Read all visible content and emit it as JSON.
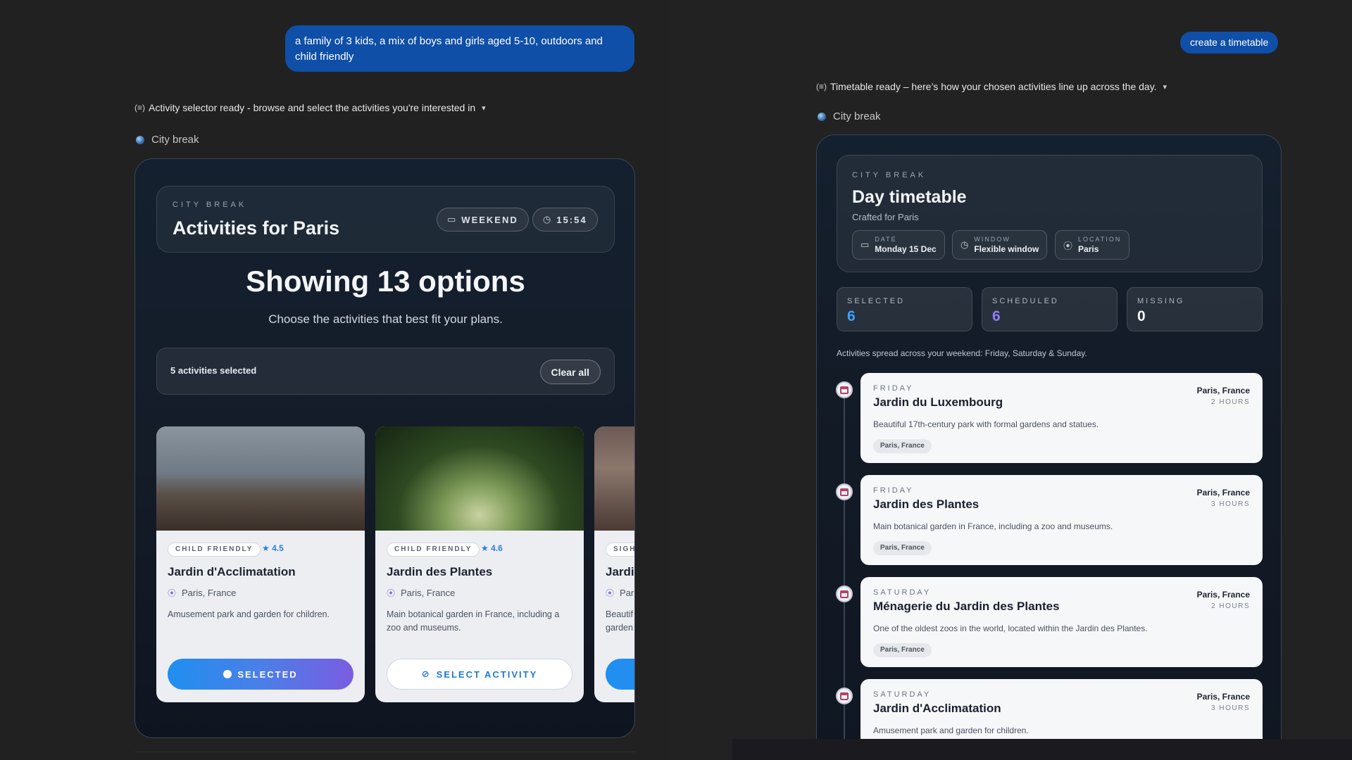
{
  "chat": {
    "user_message": "a family of 3 kids, a mix of boys and girls aged 5-10, outdoors and child friendly",
    "top_button": "create a timetable",
    "left_status": "Activity selector ready - browse and select the activities you're interested in",
    "right_status": "Timetable ready – here’s how your chosen activities line up across the day.",
    "left_source": "City break",
    "right_source": "City break"
  },
  "selector": {
    "kicker": "CITY BREAK",
    "title": "Activities for Paris",
    "pill_weekend": "WEEKEND",
    "pill_time": "15:54",
    "showing": "Showing 13 options",
    "subtitle": "Choose the activities that best fit your plans.",
    "selected_count": "5 activities selected",
    "clear_label": "Clear all",
    "cards": [
      {
        "tag": "CHILD FRIENDLY",
        "rating": "4.5",
        "name": "Jardin d'Acclimatation",
        "location": "Paris, France",
        "description": "Amusement park and garden for children.",
        "button": "SELECTED"
      },
      {
        "tag": "CHILD FRIENDLY",
        "rating": "4.6",
        "name": "Jardin des Plantes",
        "location": "Paris, France",
        "description": "Main botanical garden in France, including a zoo and museums.",
        "button": "SELECT ACTIVITY"
      },
      {
        "tag": "SIGH",
        "name": "Jardi",
        "location": "Pari",
        "description": "Beautif garden"
      }
    ]
  },
  "timetable": {
    "kicker": "CITY BREAK",
    "title": "Day timetable",
    "subtitle": "Crafted for Paris",
    "meta": [
      {
        "label": "DATE",
        "value": "Monday 15 Dec",
        "icon": "calendar-icon"
      },
      {
        "label": "WINDOW",
        "value": "Flexible window",
        "icon": "clock-icon"
      },
      {
        "label": "LOCATION",
        "value": "Paris",
        "icon": "pin-icon"
      }
    ],
    "stats": [
      {
        "label": "SELECTED",
        "value": "6",
        "color": "#3da2ff"
      },
      {
        "label": "SCHEDULED",
        "value": "6",
        "color": "#8f7cf0"
      },
      {
        "label": "MISSING",
        "value": "0",
        "color": "#f2f4f7"
      }
    ],
    "spread_note": "Activities spread across your weekend: Friday, Saturday & Sunday.",
    "items": [
      {
        "day": "FRIDAY",
        "name": "Jardin du Luxembourg",
        "location": "Paris, France",
        "duration": "2 HOURS",
        "description": "Beautiful 17th-century park with formal gardens and statues.",
        "tag": "Paris, France"
      },
      {
        "day": "FRIDAY",
        "name": "Jardin des Plantes",
        "location": "Paris, France",
        "duration": "3 HOURS",
        "description": "Main botanical garden in France, including a zoo and museums.",
        "tag": "Paris, France"
      },
      {
        "day": "SATURDAY",
        "name": "Ménagerie du Jardin des Plantes",
        "location": "Paris, France",
        "duration": "2 HOURS",
        "description": "One of the oldest zoos in the world, located within the Jardin des Plantes.",
        "tag": "Paris, France"
      },
      {
        "day": "SATURDAY",
        "name": "Jardin d'Acclimatation",
        "location": "Paris, France",
        "duration": "3 HOURS",
        "description": "Amusement park and garden for children."
      }
    ]
  }
}
